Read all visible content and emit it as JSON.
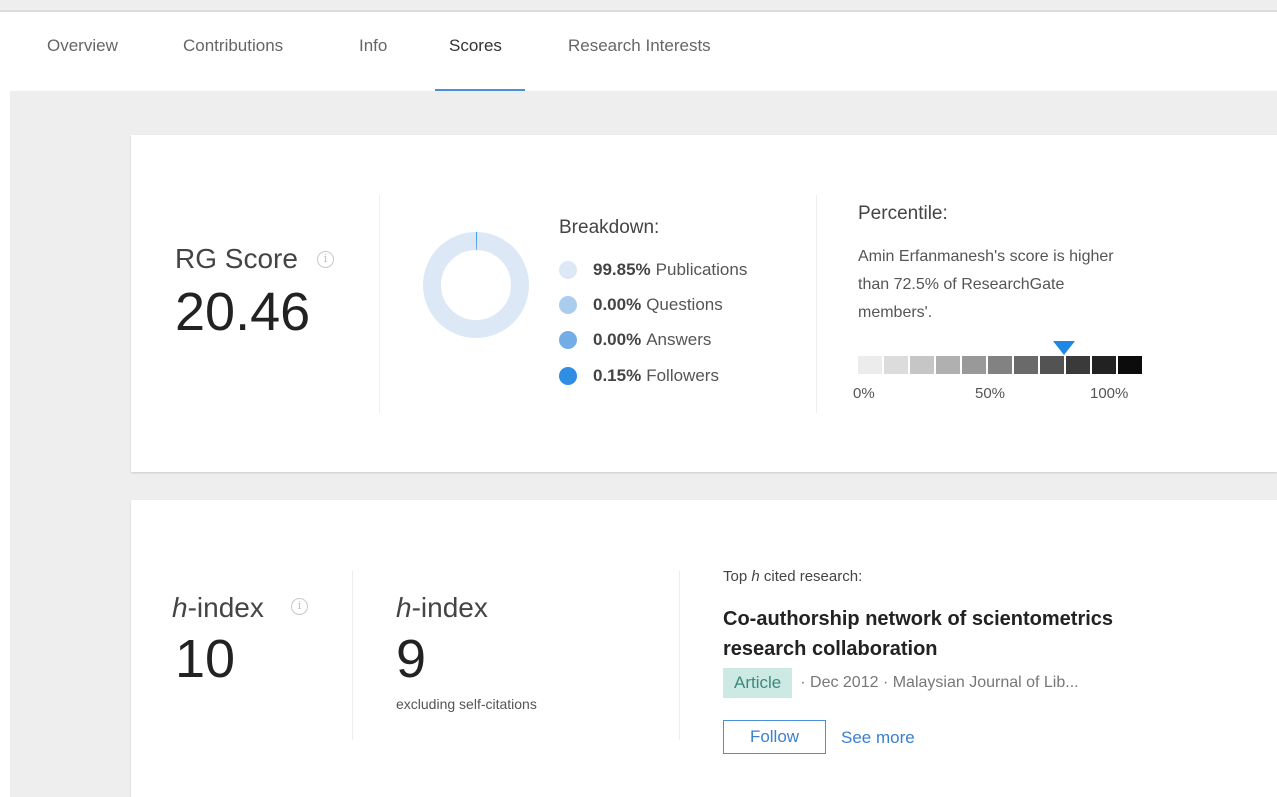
{
  "tabs": [
    {
      "label": "Overview",
      "active": false
    },
    {
      "label": "Contributions",
      "active": false
    },
    {
      "label": "Info",
      "active": false
    },
    {
      "label": "Scores",
      "active": true
    },
    {
      "label": "Research Interests",
      "active": false
    }
  ],
  "rg_score": {
    "label": "RG Score",
    "value": "20.46",
    "info_icon": "info-icon"
  },
  "breakdown": {
    "title": "Breakdown:",
    "items": [
      {
        "percent": "99.85%",
        "label": "Publications",
        "fraction": 0.9985,
        "color": "#dce8f5"
      },
      {
        "percent": "0.00%",
        "label": "Questions",
        "fraction": 0.0,
        "color": "#aacdee"
      },
      {
        "percent": "0.00%",
        "label": "Answers",
        "fraction": 0.0,
        "color": "#73ade6"
      },
      {
        "percent": "0.15%",
        "label": "Followers",
        "fraction": 0.0015,
        "color": "#2f8de4"
      }
    ]
  },
  "percentile": {
    "title": "Percentile:",
    "description": "Amin Erfanmanesh's score is higher than 72.5% of ResearchGate members'.",
    "value": 72.5,
    "ticks": [
      "0%",
      "50%",
      "100%"
    ],
    "marker_color": "#1e88e5",
    "segment_colors": [
      "#ececec",
      "#dcdcdc",
      "#c6c6c6",
      "#b0b0b0",
      "#999999",
      "#828282",
      "#6a6a6a",
      "#535353",
      "#3a3a3a",
      "#222222",
      "#0c0c0c"
    ]
  },
  "h_index": {
    "label_italic": "h",
    "label_rest": "-index",
    "value": "10",
    "info_icon": "info-icon"
  },
  "h_index_excl": {
    "label_italic": "h",
    "label_rest": "-index",
    "value": "9",
    "sub": "excluding self-citations"
  },
  "top_cited": {
    "heading_prefix": "Top ",
    "heading_italic": "h",
    "heading_suffix": " cited research:",
    "title": "Co-authorship network of scientometrics research collaboration",
    "type": "Article",
    "meta": "· Dec 2012 · Malaysian Journal of Lib...",
    "follow_label": "Follow",
    "see_more_label": "See more"
  }
}
